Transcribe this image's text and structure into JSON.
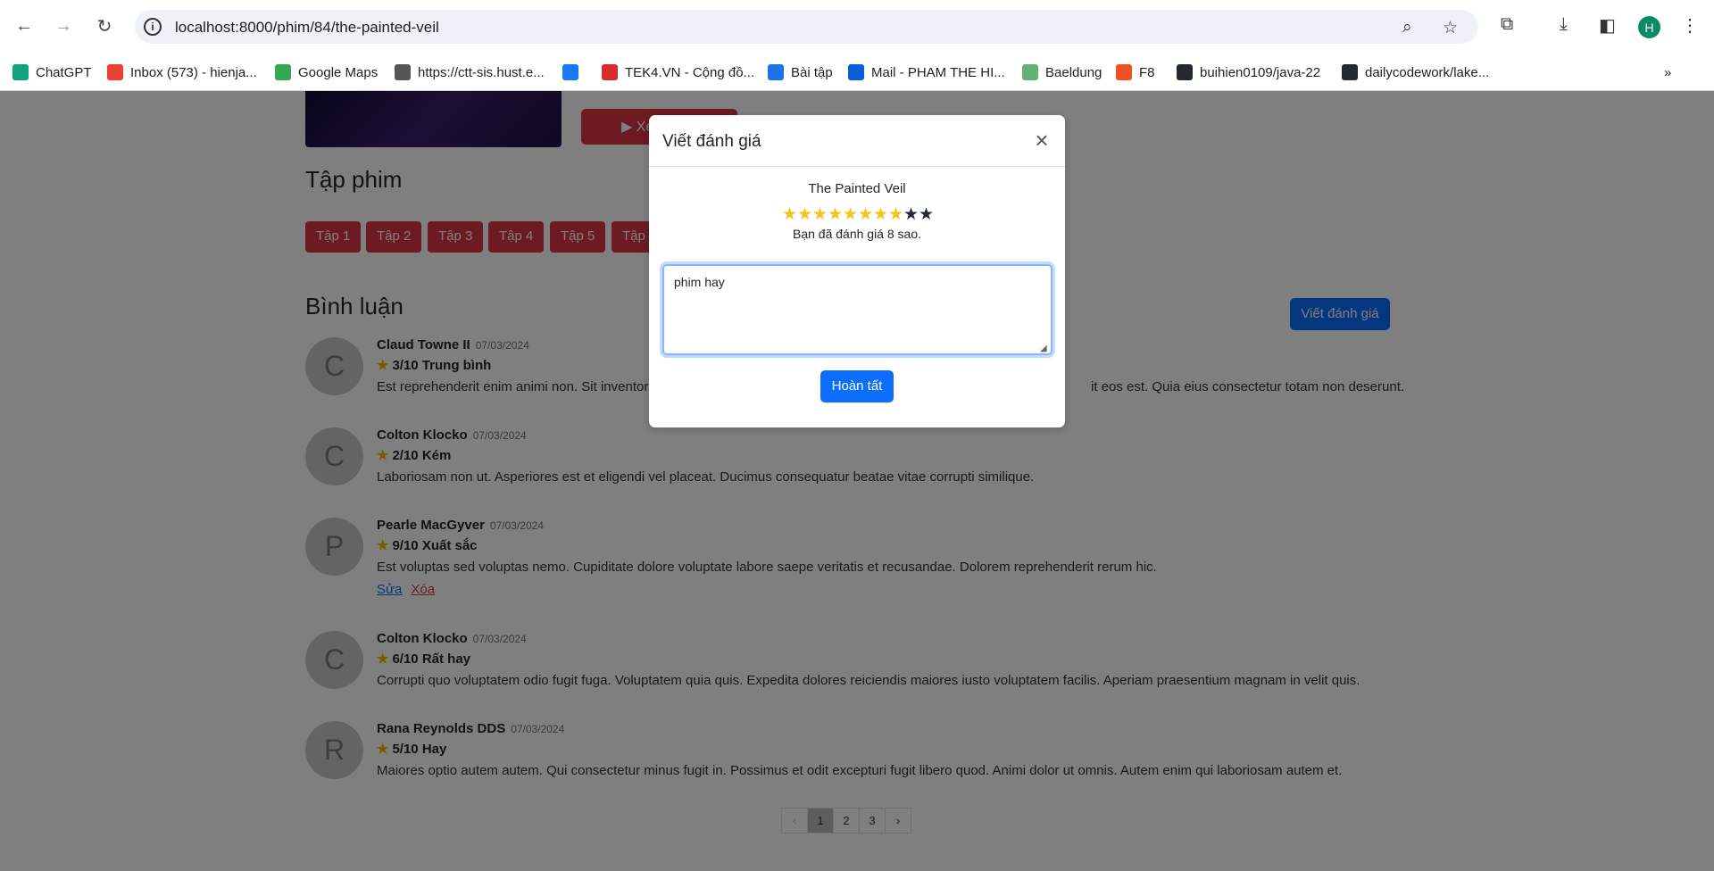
{
  "browser": {
    "url": "localhost:8000/phim/84/the-painted-veil",
    "bookmarks": [
      {
        "label": "ChatGPT",
        "icon": "chatgpt-icon",
        "color": "#10a37f"
      },
      {
        "label": "Inbox (573) - hienja...",
        "icon": "gmail-icon",
        "color": "#ea4335"
      },
      {
        "label": "Google Maps",
        "icon": "maps-icon",
        "color": "#34a853"
      },
      {
        "label": "https://ctt-sis.hust.e...",
        "icon": "globe-icon",
        "color": "#555555"
      },
      {
        "label": "",
        "icon": "facebook-icon",
        "color": "#1877f2"
      },
      {
        "label": "TEK4.VN - Cộng đồ...",
        "icon": "tek4-icon",
        "color": "#d92b2b"
      },
      {
        "label": "Bài tập",
        "icon": "tasks-icon",
        "color": "#1a73e8"
      },
      {
        "label": "Mail - PHAM THE HI...",
        "icon": "outlook-icon",
        "color": "#0a5ed7"
      },
      {
        "label": "Baeldung",
        "icon": "baeldung-icon",
        "color": "#63b175"
      },
      {
        "label": "F8",
        "icon": "f8-icon",
        "color": "#f05123"
      },
      {
        "label": "buihien0109/java-22",
        "icon": "github-icon",
        "color": "#24292f"
      },
      {
        "label": "dailycodework/lake...",
        "icon": "github-icon",
        "color": "#24292f"
      }
    ],
    "profile_initial": "H"
  },
  "page": {
    "watch_label": "Xe",
    "episodes_title": "Tập phim",
    "episodes": [
      "Tập 1",
      "Tập 2",
      "Tập 3",
      "Tập 4",
      "Tập 5",
      "Tập"
    ],
    "comments_title": "Bình luận",
    "write_review_label": "Viết đánh giá",
    "comments": [
      {
        "initial": "C",
        "name": "Claud Towne II",
        "date": "07/03/2024",
        "rating": "3/10 Trung bình",
        "text": "Est reprehenderit enim animi non. Sit inventor",
        "text_tail": "it eos est. Quia eius consectetur totam non deserunt.",
        "own": false
      },
      {
        "initial": "C",
        "name": "Colton Klocko",
        "date": "07/03/2024",
        "rating": "2/10 Kém",
        "text": "Laboriosam non ut. Asperiores est et eligendi vel placeat. Ducimus consequatur beatae vitae corrupti similique.",
        "text_tail": "",
        "own": false
      },
      {
        "initial": "P",
        "name": "Pearle MacGyver",
        "date": "07/03/2024",
        "rating": "9/10 Xuất sắc",
        "text": "Est voluptas sed voluptas nemo. Cupiditate dolore voluptate labore saepe veritatis et recusandae. Dolorem reprehenderit rerum hic.",
        "text_tail": "",
        "own": true
      },
      {
        "initial": "C",
        "name": "Colton Klocko",
        "date": "07/03/2024",
        "rating": "6/10 Rất hay",
        "text": "Corrupti quo voluptatem odio fugit fuga. Voluptatem quia quis. Expedita dolores reiciendis maiores iusto voluptatem facilis. Aperiam praesentium magnam in velit quis.",
        "text_tail": "",
        "own": false
      },
      {
        "initial": "R",
        "name": "Rana Reynolds DDS",
        "date": "07/03/2024",
        "rating": "5/10 Hay",
        "text": "Maiores optio autem autem. Qui consectetur minus fugit in. Possimus et odit excepturi fugit libero quod. Animi dolor ut omnis. Autem enim qui laboriosam autem et.",
        "text_tail": "",
        "own": false
      }
    ],
    "edit_label": "Sửa",
    "delete_label": "Xóa",
    "pagination": {
      "prev": "‹",
      "pages": [
        "1",
        "2",
        "3"
      ],
      "current": "1",
      "next": "›"
    }
  },
  "modal": {
    "title": "Viết đánh giá",
    "close": "×",
    "movie_title": "The Painted Veil",
    "rating": 8,
    "max_rating": 10,
    "rated_text": "Bạn đã đánh giá 8 sao.",
    "review_text": "phim hay",
    "submit_label": "Hoàn tất"
  }
}
